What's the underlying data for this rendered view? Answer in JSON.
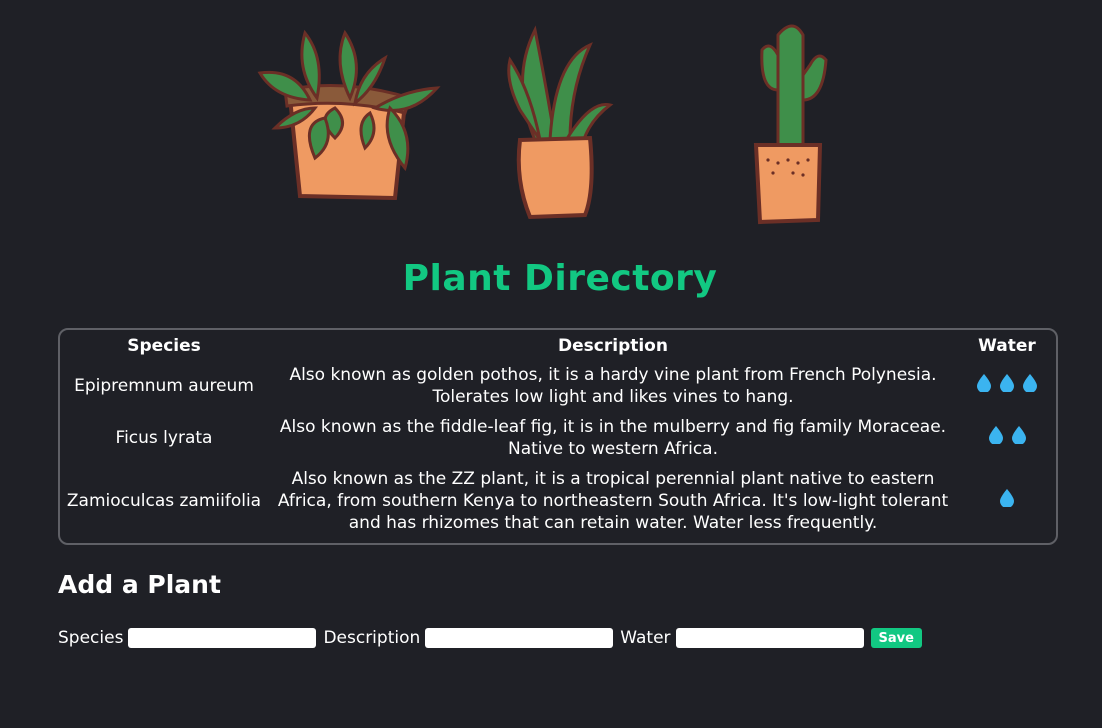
{
  "page": {
    "title": "Plant Directory"
  },
  "table": {
    "headers": {
      "species": "Species",
      "description": "Description",
      "water": "Water"
    },
    "rows": [
      {
        "species": "Epipremnum aureum",
        "description": "Also known as golden pothos, it is a hardy vine plant from French Polynesia. Tolerates low light and likes vines to hang.",
        "water": 3
      },
      {
        "species": "Ficus lyrata",
        "description": "Also known as the fiddle-leaf fig, it is in the mulberry and fig family Moraceae. Native to western Africa.",
        "water": 2
      },
      {
        "species": "Zamioculcas zamiifolia",
        "description": "Also known as the ZZ plant, it is a tropical perennial plant native to eastern Africa, from southern Kenya to northeastern South Africa. It's low-light tolerant and has rhizomes that can retain water. Water less frequently.",
        "water": 1
      }
    ]
  },
  "form": {
    "heading": "Add a Plant",
    "species_label": "Species",
    "species_value": "",
    "description_label": "Description",
    "description_value": "",
    "water_label": "Water",
    "water_value": "",
    "save_label": "Save"
  },
  "icons": {
    "water_drop": "water-drop-icon"
  },
  "colors": {
    "accent": "#12c882",
    "background": "#1f2026",
    "drop": "#3bb4f0"
  }
}
